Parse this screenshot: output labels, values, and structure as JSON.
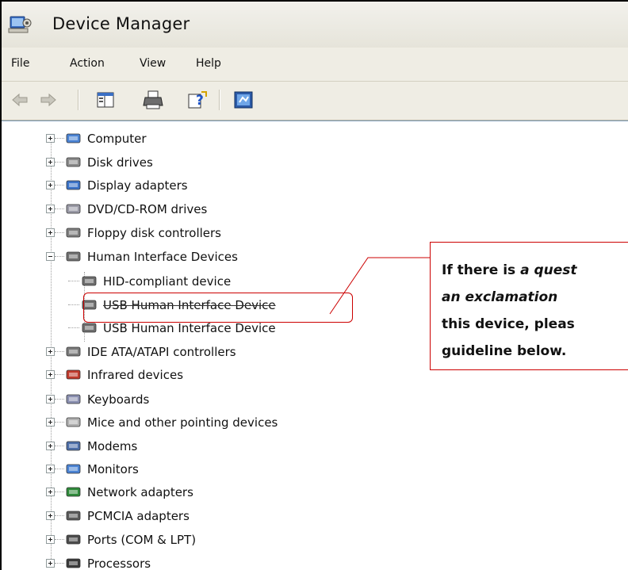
{
  "window": {
    "title": "Device Manager"
  },
  "menu": [
    "File",
    "Action",
    "View",
    "Help"
  ],
  "toolbar": [
    "back-icon",
    "forward-icon",
    "properties-icon",
    "print-icon",
    "help-icon",
    "scan-hardware-icon"
  ],
  "tree": {
    "nodes": [
      {
        "label": "Computer",
        "icon": "computer-icon"
      },
      {
        "label": "Disk drives",
        "icon": "disk-drive-icon"
      },
      {
        "label": "Display adapters",
        "icon": "display-adapter-icon"
      },
      {
        "label": "DVD/CD-ROM drives",
        "icon": "dvd-drive-icon"
      },
      {
        "label": "Floppy disk controllers",
        "icon": "floppy-controller-icon"
      },
      {
        "label": "Human Interface Devices",
        "icon": "hid-icon"
      },
      {
        "label": "HID-compliant device",
        "icon": "hid-device-icon"
      },
      {
        "label": "USB Human Interface Device",
        "icon": "hid-device-icon"
      },
      {
        "label": "USB Human Interface Device",
        "icon": "hid-device-icon"
      },
      {
        "label": "IDE ATA/ATAPI controllers",
        "icon": "ide-controller-icon"
      },
      {
        "label": "Infrared devices",
        "icon": "infrared-icon"
      },
      {
        "label": "Keyboards",
        "icon": "keyboard-icon"
      },
      {
        "label": "Mice and other pointing devices",
        "icon": "mouse-icon"
      },
      {
        "label": "Modems",
        "icon": "modem-icon"
      },
      {
        "label": "Monitors",
        "icon": "monitor-icon"
      },
      {
        "label": "Network adapters",
        "icon": "network-adapter-icon"
      },
      {
        "label": "PCMCIA adapters",
        "icon": "pcmcia-icon"
      },
      {
        "label": "Ports (COM & LPT)",
        "icon": "ports-icon"
      },
      {
        "label": "Processors",
        "icon": "processor-icon"
      }
    ]
  },
  "callout": {
    "line1_a": "If there is ",
    "line1_b": "a quest",
    "line2": "an  exclamation",
    "line3": "this device, pleas",
    "line4": "guideline below."
  },
  "colors": {
    "annotation": "#cc0000",
    "chrome": "#efede4"
  }
}
